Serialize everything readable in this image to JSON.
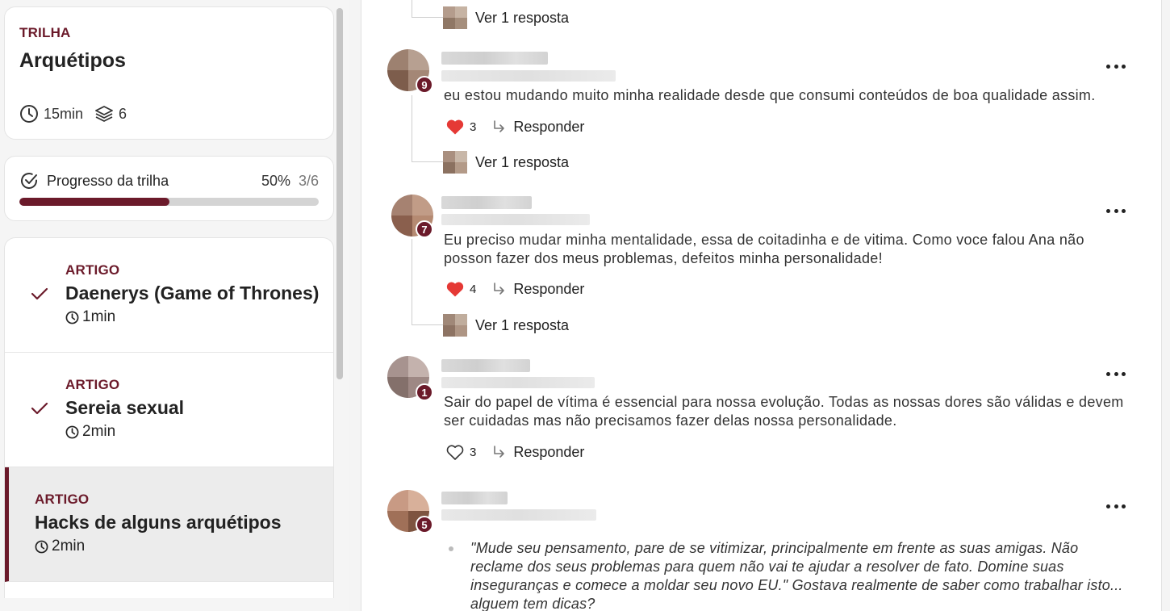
{
  "trail": {
    "eyebrow": "TRILHA",
    "title": "Arquétipos",
    "duration": "15min",
    "lessons_count": "6"
  },
  "progress": {
    "label": "Progresso da trilha",
    "percent_text": "50%",
    "fraction_text": "3/6",
    "fraction": 0.5
  },
  "lessons": [
    {
      "type": "ARTIGO",
      "title": "Daenerys (Game of Thrones)",
      "duration": "1min",
      "completed": true,
      "active": false
    },
    {
      "type": "ARTIGO",
      "title": "Sereia sexual",
      "duration": "2min",
      "completed": true,
      "active": false
    },
    {
      "type": "ARTIGO",
      "title": "Hacks de alguns arquétipos",
      "duration": "2min",
      "completed": false,
      "active": true
    }
  ],
  "comments": {
    "top_replies": "Ver 1 resposta",
    "items": [
      {
        "level": "9",
        "text": "eu estou mudando muito minha realidade desde que consumi conteúdos de boa qualidade assim.",
        "likes": "3",
        "liked": true,
        "reply_label": "Responder",
        "replies_label": "Ver 1 resposta"
      },
      {
        "level": "7",
        "text": "Eu preciso mudar minha mentalidade, essa de coitadinha e de vitima. Como voce falou Ana não posson fazer dos meus problemas, defeitos minha personalidade!",
        "likes": "4",
        "liked": true,
        "reply_label": "Responder",
        "replies_label": "Ver 1 resposta"
      },
      {
        "level": "1",
        "text": "Sair do papel de vítima é essencial para nossa evolução. Todas as nossas dores são válidas e devem ser cuidadas mas não precisamos fazer delas nossa personalidade.",
        "likes": "3",
        "liked": false,
        "reply_label": "Responder"
      },
      {
        "level": "5",
        "quote": "\"Mude seu pensamento, pare de se vitimizar, principalmente em frente as suas amigas. Não reclame dos seus problemas para quem não vai te ajudar a resolver de fato. Domine suas inseguranças e comece a moldar seu novo EU.\" Gostava realmente de saber como trabalhar isto... alguem tem dicas?"
      }
    ]
  },
  "colors": {
    "accent": "#6b1a2a",
    "heart": "#e53935"
  }
}
